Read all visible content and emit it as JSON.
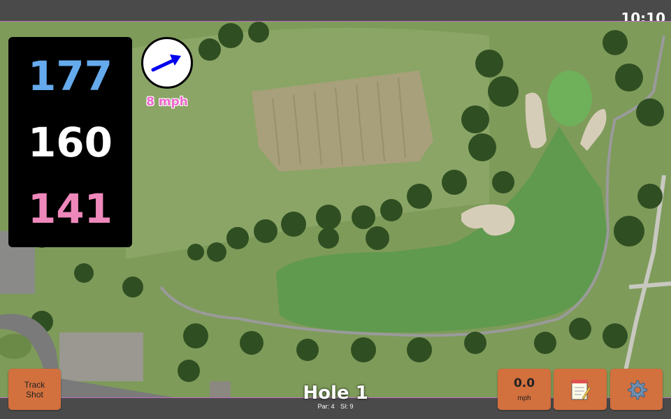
{
  "status_bar": {
    "time": "10:10"
  },
  "yardages": {
    "back": "177",
    "center": "160",
    "front": "141"
  },
  "wind": {
    "speed_label": "8 mph",
    "arrow_icon": "wind-arrow-icon"
  },
  "track_shot": {
    "label_line1": "Track",
    "label_line2": "Shot"
  },
  "speed_button": {
    "value": "0.0",
    "unit": "mph"
  },
  "notes_button": {
    "icon": "notepad-icon"
  },
  "settings_button": {
    "icon": "gear-icon"
  },
  "hole": {
    "title": "Hole 1",
    "par": "Par: 4",
    "si": "SI: 9"
  },
  "colors": {
    "back_yardage": "#66aaee",
    "center_yardage": "#ffffff",
    "front_yardage": "#ee88bb",
    "wind_label": "#ee66cc",
    "button": "#d2703e",
    "arrow": "#0000ee"
  }
}
